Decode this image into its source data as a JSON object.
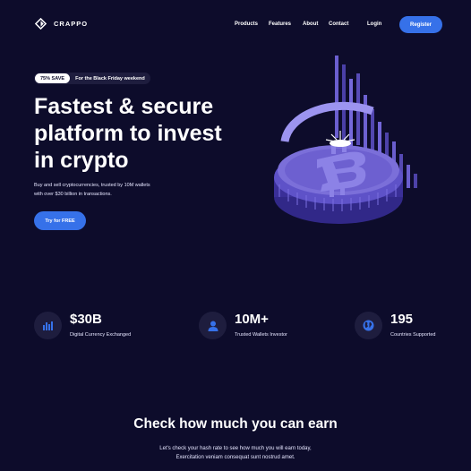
{
  "brand": {
    "name": "CRAPPO"
  },
  "nav": {
    "links": [
      "Products",
      "Features",
      "About",
      "Contact"
    ],
    "login": "Login",
    "register": "Register"
  },
  "hero": {
    "promo_badge": "75% SAVE",
    "promo_text": "For the Black Friday weekend",
    "title_lines": [
      "Fastest & secure",
      "platform to invest",
      "in crypto"
    ],
    "description_lines": [
      "Buy and sell cryptocurrencies, trusted by 10M wallets",
      "with over $30 billion in transactions."
    ],
    "cta": "Try for FREE"
  },
  "stats": [
    {
      "value": "$30B",
      "label": "Digital Currency Exchanged",
      "icon": "bar-chart-icon"
    },
    {
      "value": "10M+",
      "label": "Trusted Wallets Investor",
      "icon": "user-icon"
    },
    {
      "value": "195",
      "label": "Countries Supported",
      "icon": "globe-icon"
    }
  ],
  "earn": {
    "title": "Check how much you can earn",
    "description_lines": [
      "Let's check your hash rate to see how much you will earn today,",
      "Exercitation veniam consequat sunt nostrud amet."
    ]
  },
  "colors": {
    "background": "#0d0c2b",
    "accent": "#3671e9",
    "surface": "#1e1d3e",
    "coin": "#7b6fd9"
  }
}
